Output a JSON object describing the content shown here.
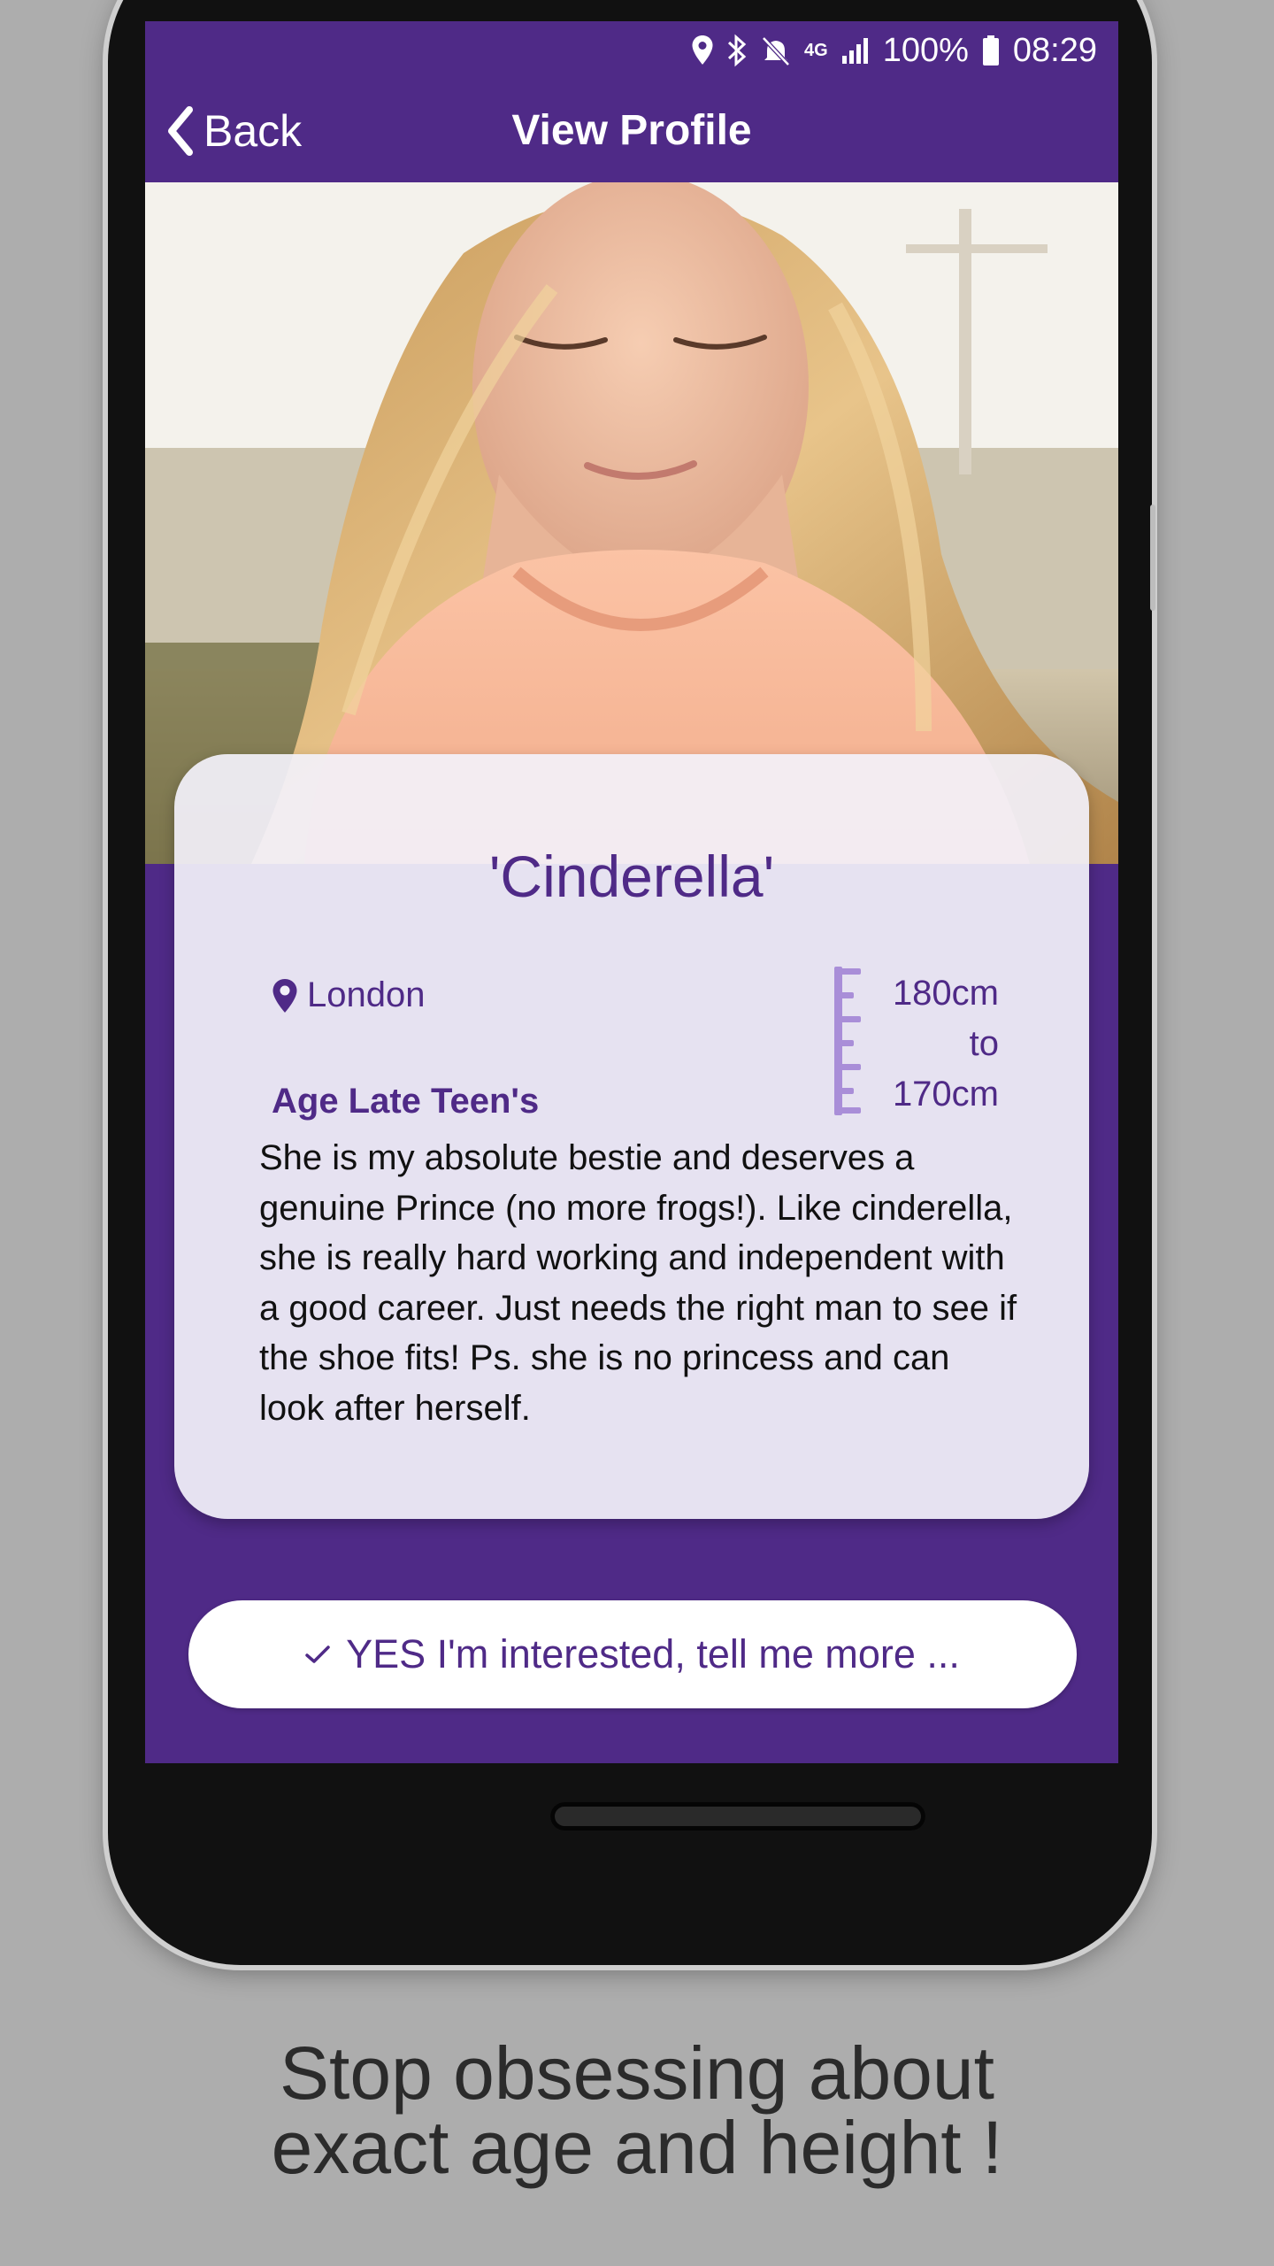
{
  "status_bar": {
    "battery": "100%",
    "time": "08:29",
    "network": "4G",
    "icons": [
      "location-icon",
      "bluetooth-icon",
      "mute-icon",
      "4g-icon",
      "signal-icon",
      "battery-icon"
    ]
  },
  "navbar": {
    "back_label": "Back",
    "title": "View Profile"
  },
  "profile": {
    "nickname": "'Cinderella'",
    "location": "London",
    "age": "Age Late Teen's",
    "height_from": "180cm",
    "height_to_word": "to",
    "height_to": "170cm",
    "description": "She is my absolute bestie and deserves a genuine Prince (no more frogs!). Like cinderella, she is really hard working and independent with a good career. Just needs the right man to see if the shoe fits! Ps. she is no princess and can look after herself."
  },
  "cta": {
    "label": "YES I'm interested, tell me more ..."
  },
  "caption": {
    "line1": "Stop obsessing about",
    "line2": "exact age and height !"
  },
  "colors": {
    "primary": "#4f2a87",
    "background": "#adadad",
    "card": "#f2f0f9",
    "ruler": "#a98ed8"
  }
}
